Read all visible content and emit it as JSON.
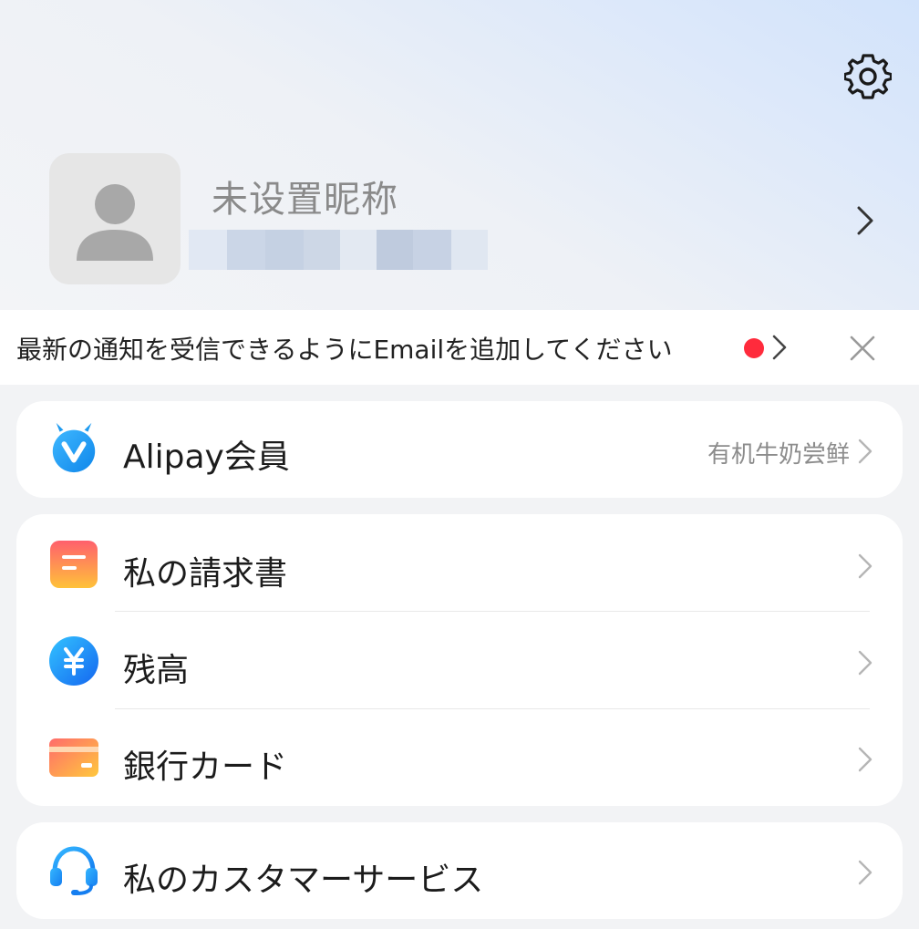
{
  "profile": {
    "nickname": "未设置昵称"
  },
  "notice": {
    "text": "最新の通知を受信できるようにEmailを追加してください"
  },
  "member": {
    "label": "Alipay会員",
    "sub": "有机牛奶尝鲜"
  },
  "finance": {
    "items": [
      {
        "label": "私の請求書",
        "icon": "bill-icon"
      },
      {
        "label": "残高",
        "icon": "yen-balance-icon"
      },
      {
        "label": "銀行カード",
        "icon": "bank-card-icon"
      }
    ]
  },
  "service": {
    "label": "私のカスタマーサービス",
    "icon": "headset-icon"
  },
  "colors": {
    "accent_blue": "#1e9bf0",
    "red_dot": "#ff2b3c",
    "bill_orange": "#ff6a5f",
    "card_orange": "#ff8a4a"
  }
}
